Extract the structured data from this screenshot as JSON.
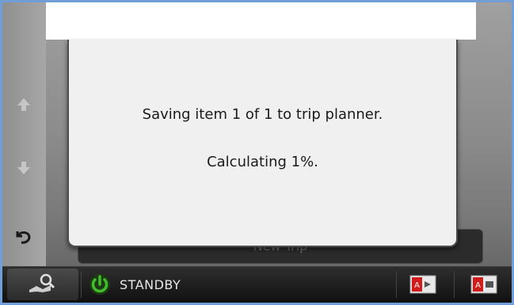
{
  "dialog": {
    "line1": "Saving item 1 of 1 to trip planner.",
    "line2": "Calculating 1%."
  },
  "background": {
    "button_label": "New Trip"
  },
  "bottom_bar": {
    "status_label": "STANDBY"
  },
  "icons": {
    "up": "arrow-up-icon",
    "down": "arrow-down-icon",
    "back": "back-icon",
    "search": "map-search-icon",
    "power": "power-icon",
    "source1": "av-source-icon",
    "source2": "media-source-icon"
  },
  "colors": {
    "frame_border": "#6f9fd6",
    "dialog_bg": "#f0f0f0",
    "power_green": "#3fbf2a"
  }
}
